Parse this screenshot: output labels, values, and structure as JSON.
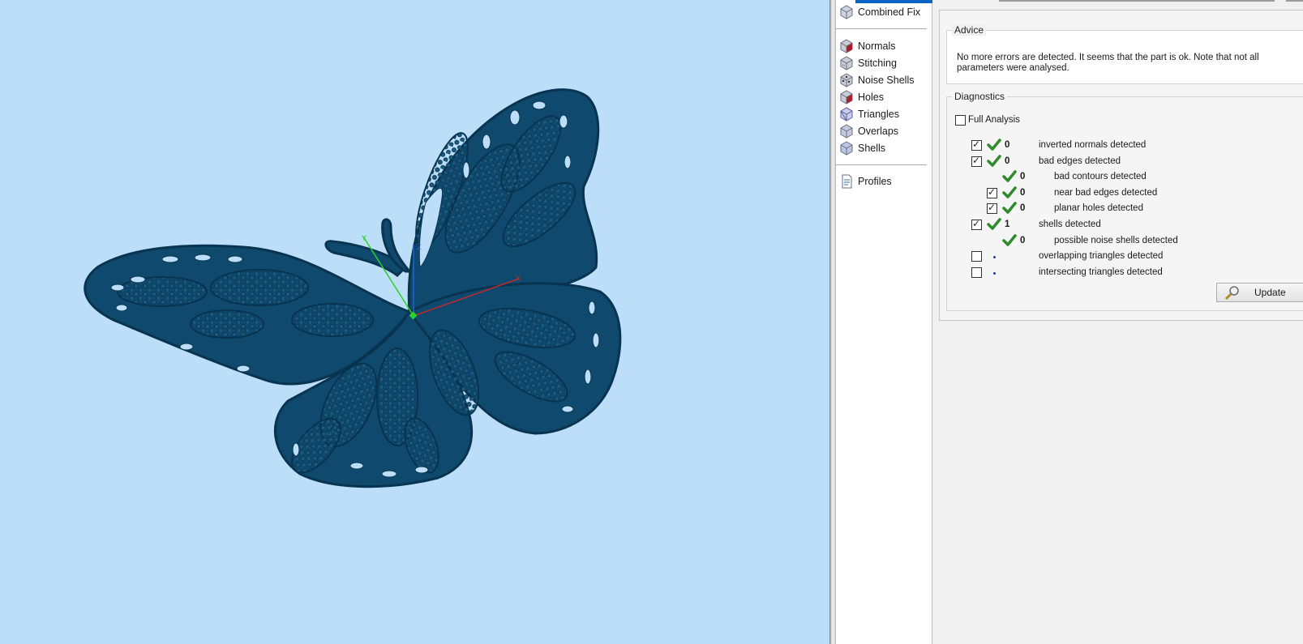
{
  "nav": {
    "top_items": [
      {
        "label": "Combined Fix",
        "icon": "combined-fix-cube-icon"
      }
    ],
    "fix_items": [
      {
        "label": "Normals",
        "icon": "normals-cube-icon"
      },
      {
        "label": "Stitching",
        "icon": "stitching-cube-icon"
      },
      {
        "label": "Noise Shells",
        "icon": "noise-shells-cube-icon"
      },
      {
        "label": "Holes",
        "icon": "holes-cube-icon"
      },
      {
        "label": "Triangles",
        "icon": "triangles-cube-icon"
      },
      {
        "label": "Overlaps",
        "icon": "overlaps-cube-icon"
      },
      {
        "label": "Shells",
        "icon": "shells-cube-icon"
      }
    ],
    "bottom_items": [
      {
        "label": "Profiles",
        "icon": "profiles-document-icon"
      }
    ]
  },
  "advice": {
    "title": "Advice",
    "text": "No more errors are detected. It seems that the part is ok. Note that not all parameters were analysed."
  },
  "diagnostics": {
    "title": "Diagnostics",
    "full_analysis_label": "Full Analysis",
    "full_analysis_checked": false,
    "rows": [
      {
        "count": "0",
        "label": "inverted normals detected",
        "indent": 0,
        "checkbox": true,
        "checked": true,
        "status": "ok"
      },
      {
        "count": "0",
        "label": "bad edges detected",
        "indent": 0,
        "checkbox": true,
        "checked": true,
        "status": "ok"
      },
      {
        "count": "0",
        "label": "bad contours detected",
        "indent": 1,
        "checkbox": false,
        "checked": false,
        "status": "ok"
      },
      {
        "count": "0",
        "label": "near bad edges detected",
        "indent": 1,
        "checkbox": true,
        "checked": true,
        "status": "ok"
      },
      {
        "count": "0",
        "label": "planar holes detected",
        "indent": 1,
        "checkbox": true,
        "checked": true,
        "status": "ok"
      },
      {
        "count": "1",
        "label": "shells detected",
        "indent": 0,
        "checkbox": true,
        "checked": true,
        "status": "ok"
      },
      {
        "count": "0",
        "label": "possible noise shells detected",
        "indent": 1,
        "checkbox": false,
        "checked": false,
        "status": "ok"
      },
      {
        "count": "",
        "label": "overlapping triangles detected",
        "indent": 0,
        "checkbox": true,
        "checked": false,
        "status": "not-analysed"
      },
      {
        "count": "",
        "label": "intersecting triangles detected",
        "indent": 0,
        "checkbox": true,
        "checked": false,
        "status": "not-analysed"
      }
    ],
    "update_label": "Update",
    "update_icon": "magnifier-icon"
  },
  "viewport": {
    "model": "butterfly-mesh",
    "axis_labels": [
      "Y",
      "Z",
      "X"
    ],
    "colors": {
      "background": "#bcdef8",
      "model": "#0f4a6e",
      "model_edge": "#08344f",
      "x_axis": "#c0282e",
      "y_axis": "#2bd02b",
      "z_axis": "#1f62d8"
    }
  },
  "colors": {
    "check_green": "#2f8a2c",
    "selection_blue": "#0a64c8",
    "status_dot": "#1a37c8"
  }
}
